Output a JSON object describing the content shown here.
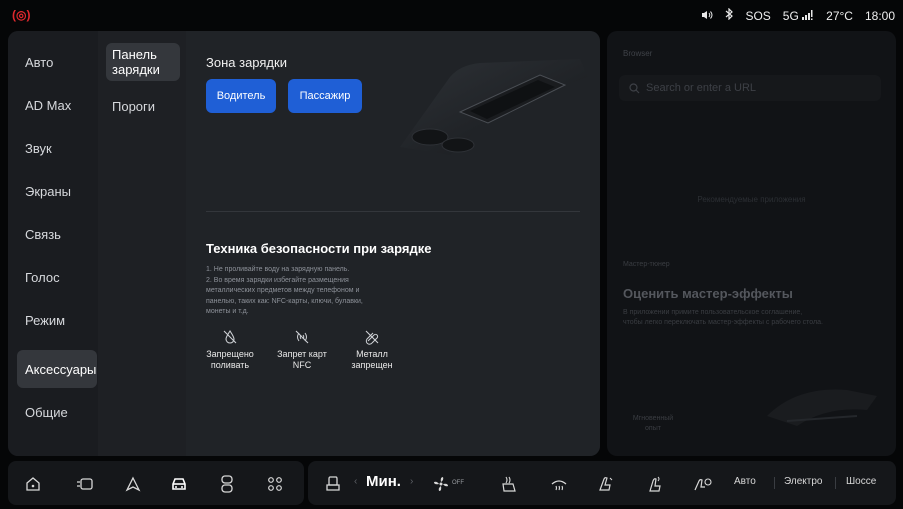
{
  "status": {
    "rec_icon": "(◎)",
    "sos": "SOS",
    "network": "5G",
    "temperature": "27°C",
    "time": "18:00"
  },
  "sidebar": {
    "items": [
      {
        "label": "Авто"
      },
      {
        "label": "AD Max"
      },
      {
        "label": "Звук"
      },
      {
        "label": "Экраны"
      },
      {
        "label": "Связь"
      },
      {
        "label": "Голос"
      },
      {
        "label": "Режим"
      },
      {
        "label": "Аксессуары"
      },
      {
        "label": "Общие"
      }
    ],
    "active": "Аксессуары"
  },
  "subnav": {
    "items": [
      {
        "label": "Панель зарядки"
      },
      {
        "label": "Пороги"
      }
    ],
    "active": "Панель зарядки"
  },
  "charging": {
    "zone_title": "Зона зарядки",
    "driver_button": "Водитель",
    "passenger_button": "Пассажир",
    "safety_title": "Техника безопасности при зарядке",
    "safety_lines": [
      "1. Не проливайте воду на зарядную панель.",
      "2. Во время зарядки избегайте размещения",
      "металлических предметов между телефоном и",
      "панелью, таких как: NFC-карты, ключи, булавки,",
      "монеты и т.д."
    ],
    "warnings": [
      {
        "label1": "Запрещено",
        "label2": "поливать",
        "icon": "no-water-icon"
      },
      {
        "label1": "Запрет карт",
        "label2": "NFC",
        "icon": "no-nfc-icon"
      },
      {
        "label1": "Металл",
        "label2": "запрещен",
        "icon": "no-metal-icon"
      }
    ]
  },
  "browser": {
    "label": "Browser",
    "search_placeholder": "Search or enter a URL",
    "center_note": "Рекомендуемые приложения",
    "small_label": "Мастер-тюнер",
    "headline": "Оценить мастер-эффекты",
    "desc_line1": "В приложении примите пользовательское соглашение,",
    "desc_line2": "чтобы легко переключать мастер-эффекты с рабочего стола.",
    "instant_line1": "Мгновенный",
    "instant_line2": "опыт"
  },
  "dock": {
    "climate_level": "Мин.",
    "fan_state": "OFF",
    "mode_auto": "Авто",
    "mode_electro": "Электро",
    "mode_highway": "Шоссе"
  }
}
